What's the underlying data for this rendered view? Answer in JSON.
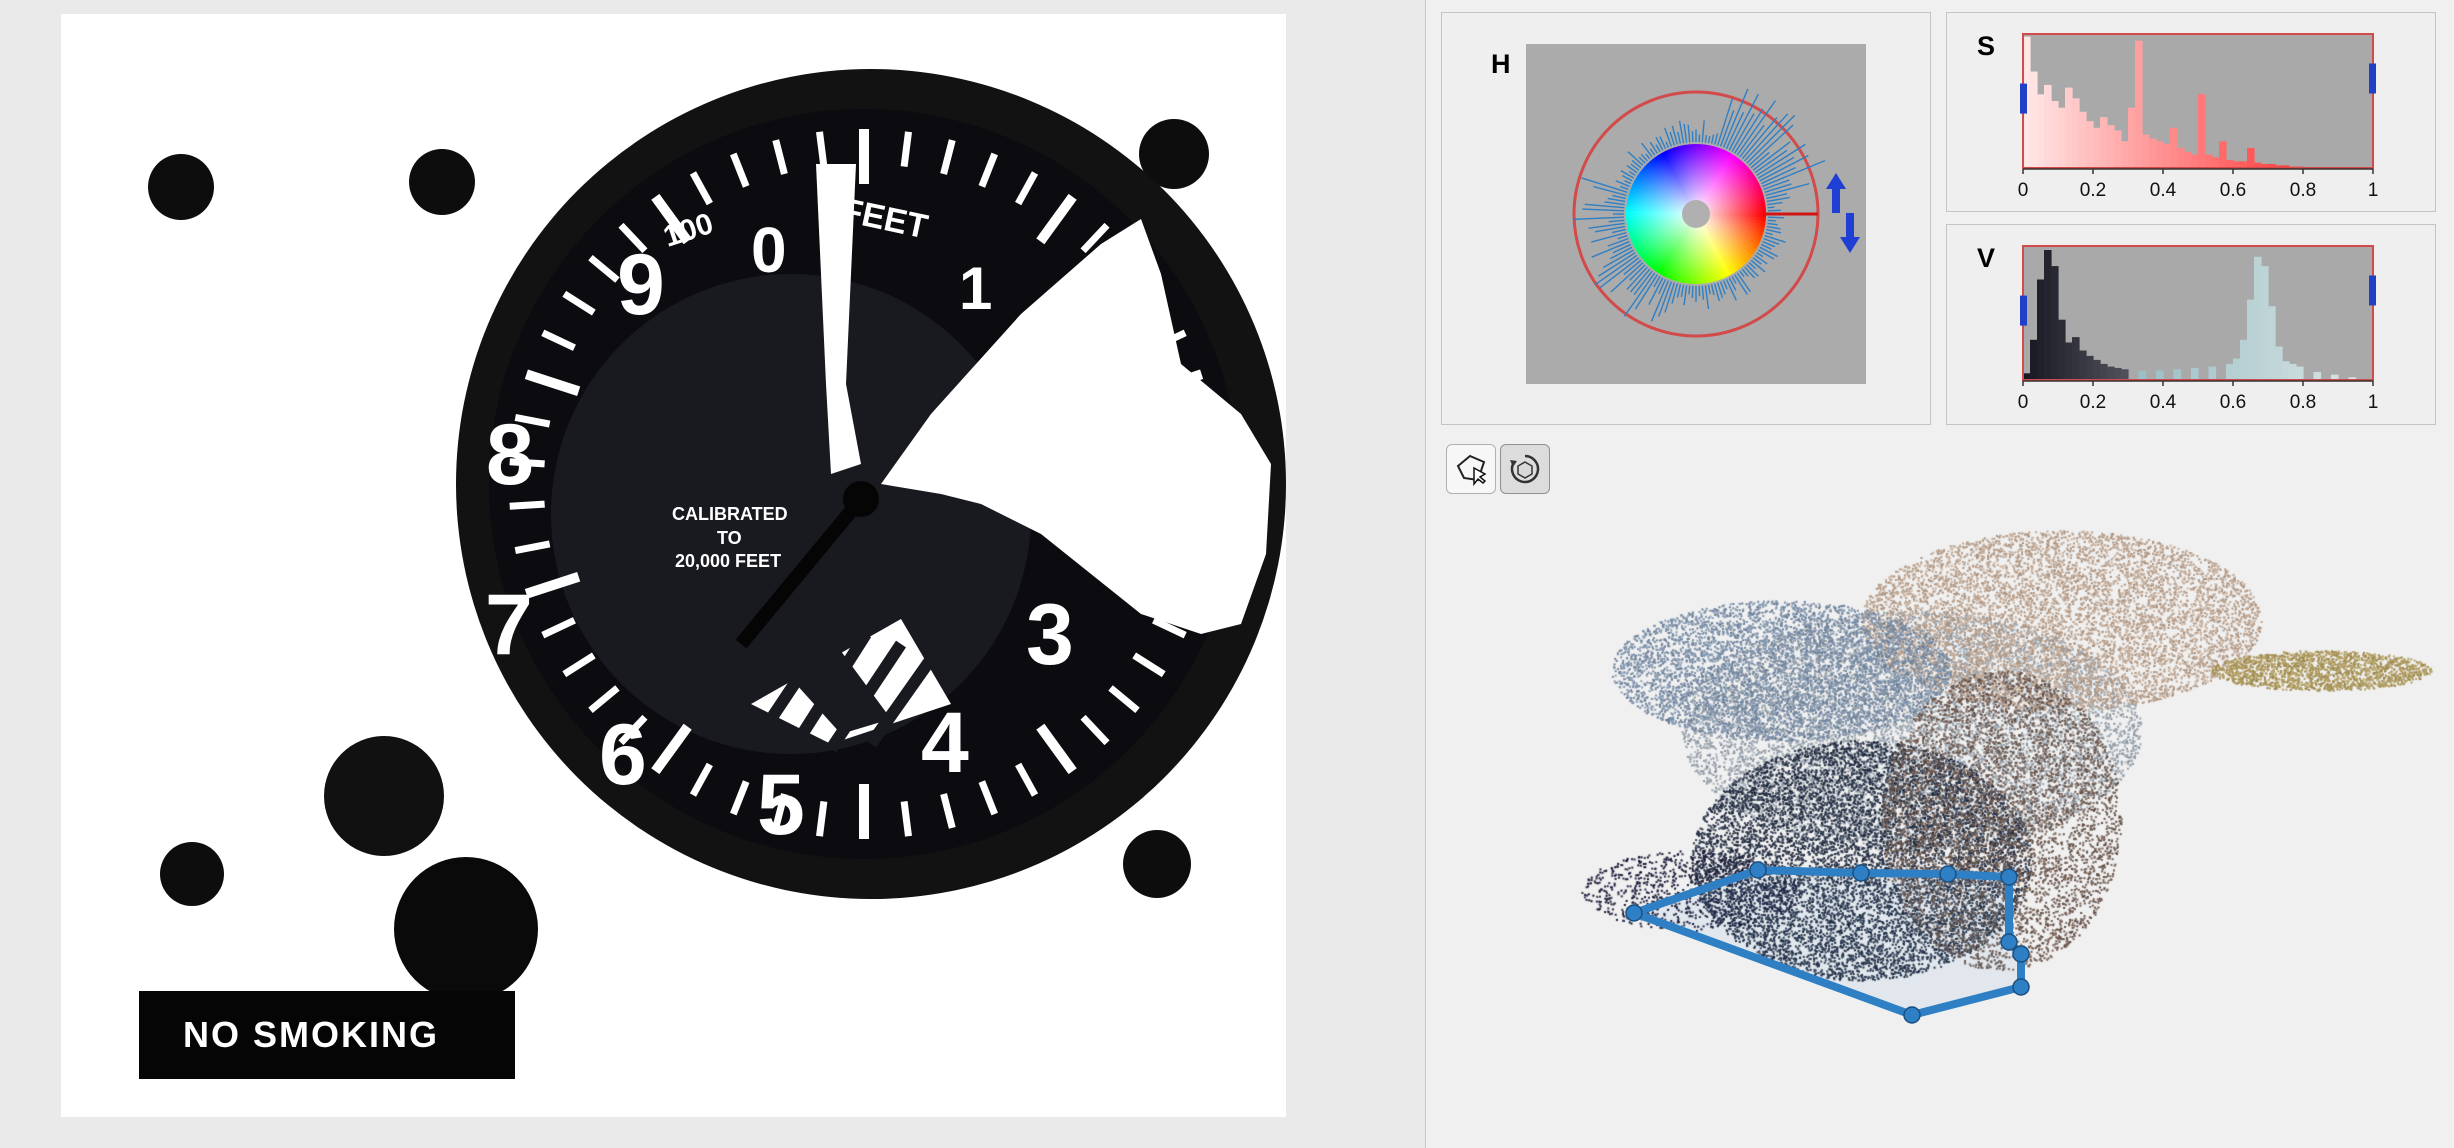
{
  "app": {
    "title": ""
  },
  "left_image": {
    "dial_numbers": [
      "0",
      "1",
      "3",
      "4",
      "5",
      "6",
      "7",
      "8",
      "9"
    ],
    "dial_top_text": "100",
    "dial_unit": "FEET",
    "calibration_line1": "CALIBRATED",
    "calibration_line2": "TO",
    "calibration_line3": "20,000 FEET",
    "sign_text": "NO SMOKING"
  },
  "hue_panel": {
    "label": "H"
  },
  "saturation_panel": {
    "label": "S",
    "tick_labels": [
      "0",
      "0.2",
      "0.4",
      "0.6",
      "0.8",
      "1"
    ]
  },
  "value_panel": {
    "label": "V",
    "tick_labels": [
      "0",
      "0.2",
      "0.4",
      "0.6",
      "0.8",
      "1"
    ]
  },
  "toolbar": {
    "tools": [
      {
        "name": "polygon-select-tool",
        "active": false
      },
      {
        "name": "rotate-3d-tool",
        "active": true
      }
    ]
  },
  "colors": {
    "histogram_bg": "#a9a9a9",
    "histogram_border": "#d24a4a",
    "range_handle": "#2040c8",
    "polygon_stroke": "#2f7fc4",
    "sat_fill": "#ff5a5a"
  },
  "chart_data": [
    {
      "type": "histogram",
      "label": "S",
      "xlim": [
        0,
        1
      ],
      "x": [
        0.02,
        0.04,
        0.06,
        0.08,
        0.1,
        0.12,
        0.14,
        0.16,
        0.18,
        0.2,
        0.22,
        0.24,
        0.26,
        0.28,
        0.3,
        0.32,
        0.34,
        0.36,
        0.38,
        0.4,
        0.42,
        0.44,
        0.46,
        0.48,
        0.5,
        0.52,
        0.54,
        0.56,
        0.58,
        0.6,
        0.62,
        0.64,
        0.66,
        0.68,
        0.7,
        0.72,
        0.74,
        0.76,
        0.78,
        0.8
      ],
      "values": [
        0.98,
        0.72,
        0.55,
        0.62,
        0.5,
        0.45,
        0.6,
        0.52,
        0.42,
        0.35,
        0.3,
        0.38,
        0.32,
        0.28,
        0.2,
        0.45,
        0.95,
        0.25,
        0.22,
        0.2,
        0.18,
        0.3,
        0.15,
        0.12,
        0.1,
        0.55,
        0.1,
        0.08,
        0.2,
        0.06,
        0.05,
        0.05,
        0.15,
        0.04,
        0.03,
        0.03,
        0.02,
        0.02,
        0.01,
        0.01
      ]
    },
    {
      "type": "histogram",
      "label": "V",
      "xlim": [
        0,
        1
      ],
      "x": [
        0.02,
        0.04,
        0.06,
        0.08,
        0.1,
        0.12,
        0.14,
        0.16,
        0.18,
        0.2,
        0.22,
        0.24,
        0.26,
        0.28,
        0.3,
        0.35,
        0.4,
        0.45,
        0.5,
        0.55,
        0.6,
        0.62,
        0.64,
        0.66,
        0.68,
        0.7,
        0.72,
        0.74,
        0.76,
        0.78,
        0.8,
        0.85,
        0.9,
        0.95
      ],
      "values": [
        0.05,
        0.3,
        0.75,
        0.97,
        0.85,
        0.45,
        0.28,
        0.32,
        0.22,
        0.18,
        0.15,
        0.12,
        0.1,
        0.09,
        0.08,
        0.07,
        0.07,
        0.08,
        0.09,
        0.1,
        0.12,
        0.16,
        0.3,
        0.6,
        0.92,
        0.85,
        0.55,
        0.25,
        0.14,
        0.12,
        0.1,
        0.06,
        0.04,
        0.02
      ]
    }
  ]
}
